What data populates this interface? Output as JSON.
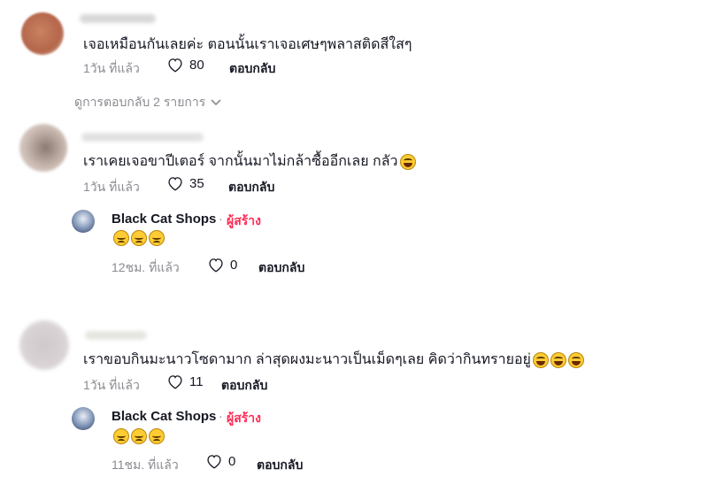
{
  "comments": [
    {
      "text": "เจอเหมือนกันเลยค่ะ ตอนนั้นเราเจอเศษๆพลาสติดสีใสๆ",
      "time": "1วัน ที่แล้ว",
      "likes": "80",
      "reply_label": "ตอบกลับ",
      "view_replies": "ดูการตอบกลับ 2 รายการ"
    },
    {
      "text": "เราเคยเจอขาปีเตอร์ จากนั้นมาไม่กล้าซื้ออีกเลย กลัว",
      "time": "1วัน ที่แล้ว",
      "likes": "35",
      "reply_label": "ตอบกลับ",
      "reply": {
        "author": "Black Cat Shops",
        "separator": "·",
        "badge": "ผู้สร้าง",
        "time": "12ชม. ที่แล้ว",
        "likes": "0",
        "reply_label": "ตอบกลับ"
      }
    },
    {
      "text": "เราขอบกินมะนาวโซดามาก ล่าสุดผงมะนาวเป็นเม็ดๆเลย คิดว่ากินทรายอยู่",
      "time": "1วัน ที่แล้ว",
      "likes": "11",
      "reply_label": "ตอบกลับ",
      "reply": {
        "author": "Black Cat Shops",
        "separator": "·",
        "badge": "ผู้สร้าง",
        "time": "11ชม. ที่แล้ว",
        "likes": "0",
        "reply_label": "ตอบกลับ"
      }
    }
  ],
  "icons": {
    "heart": "heart-outline-icon",
    "chevron": "chevron-down-icon",
    "emoji_laugh": "tears-of-joy-emoji",
    "emoji_sad": "pleading-face-emoji"
  },
  "colors": {
    "creator_badge": "#fe2c55",
    "meta_text": "#8a8b91"
  }
}
